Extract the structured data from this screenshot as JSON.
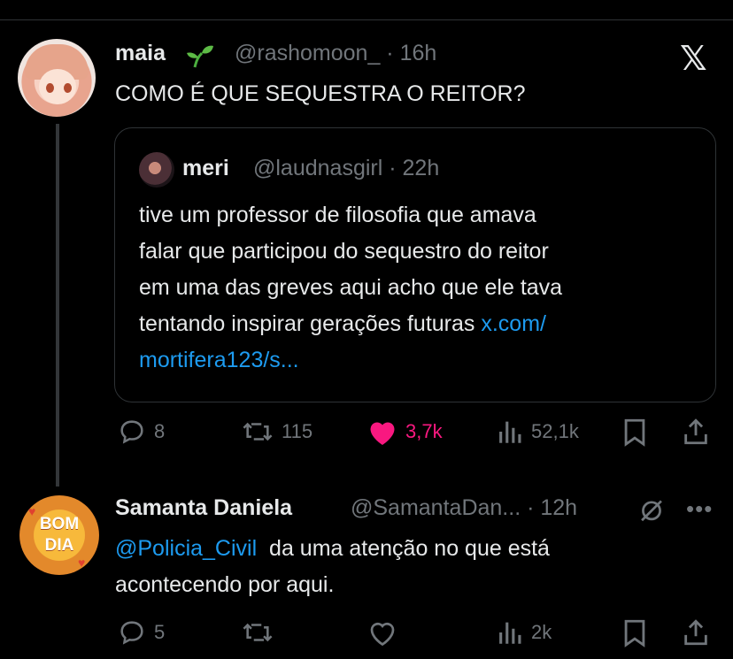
{
  "tweet": {
    "name": "maia",
    "sprout_icon": "seedling-icon",
    "handle_time": "@rashomoon_ · 16h",
    "text": "COMO É QUE SEQUESTRA O REITOR?"
  },
  "quoted": {
    "name": "meri",
    "handle_time": "@laudnasgirl · 22h",
    "lines": [
      "tive um professor de filosofia que amava",
      "falar que participou do sequestro do reitor",
      "em uma das greves aqui acho que ele tava",
      "tentando inspirar gerações futuras "
    ],
    "link_part1": "x.com/",
    "link_part2": "mortifera123/s..."
  },
  "tweet_actions": {
    "replies": "8",
    "reposts": "115",
    "likes": "3,7k",
    "views": "52,1k"
  },
  "reply": {
    "name": "Samanta Daniela",
    "handle_time": "@SamantaDan... · 12h",
    "avatar_text_line1": "BOM",
    "avatar_text_line2": "DIA",
    "mention": "@Policia_Civil",
    "text_rest": "  da uma atenção no que está",
    "text_line2": "acontecendo por aqui."
  },
  "reply_actions": {
    "replies": "5",
    "views": "2k"
  },
  "colors": {
    "background": "#000000",
    "text": "#e7e9ea",
    "muted": "#71767b",
    "link": "#1d9bf0",
    "like": "#f91880"
  }
}
